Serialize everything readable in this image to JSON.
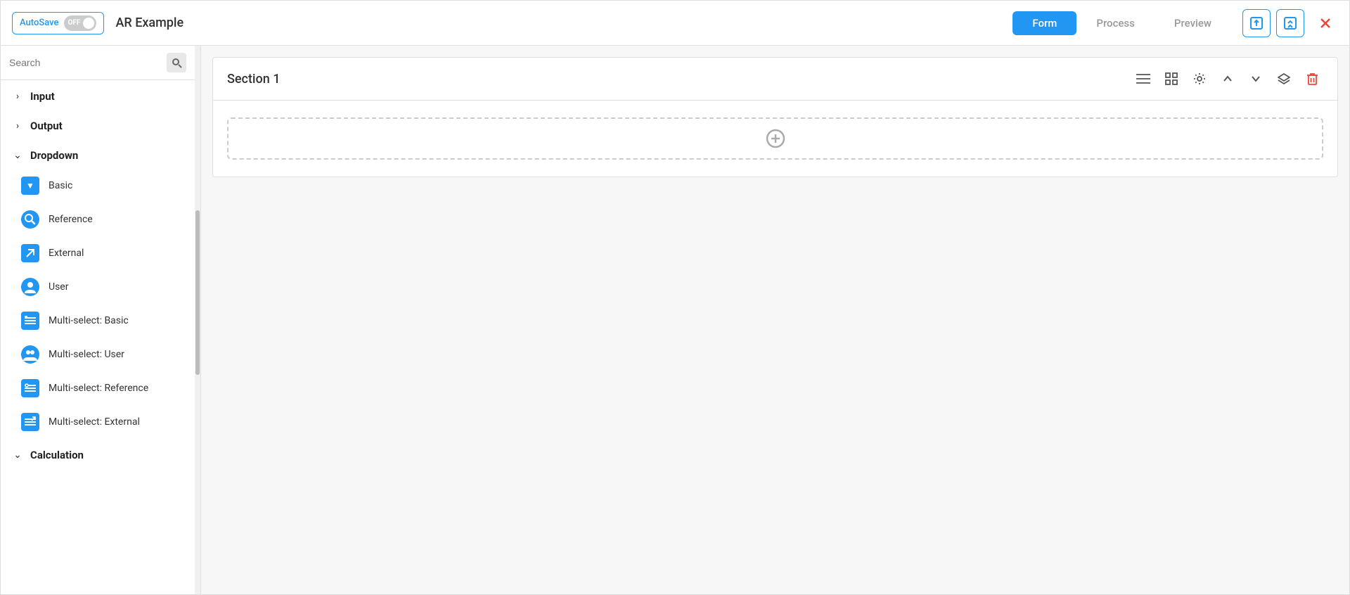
{
  "header": {
    "autosave_label": "AutoSave",
    "toggle_state": "OFF",
    "app_title": "AR Example",
    "tabs": [
      {
        "id": "form",
        "label": "Form",
        "active": true
      },
      {
        "id": "process",
        "label": "Process",
        "active": false
      },
      {
        "id": "preview",
        "label": "Preview",
        "active": false
      }
    ],
    "icon_export": "⬜",
    "icon_share": "⬛",
    "close_label": "✕"
  },
  "sidebar": {
    "search_placeholder": "Search",
    "groups": [
      {
        "id": "input",
        "label": "Input",
        "expanded": false,
        "chevron": "›"
      },
      {
        "id": "output",
        "label": "Output",
        "expanded": false,
        "chevron": "›"
      },
      {
        "id": "dropdown",
        "label": "Dropdown",
        "expanded": true,
        "chevron": "⌄",
        "items": [
          {
            "id": "basic",
            "label": "Basic",
            "icon": "dropdown-basic"
          },
          {
            "id": "reference",
            "label": "Reference",
            "icon": "reference"
          },
          {
            "id": "external",
            "label": "External",
            "icon": "external"
          },
          {
            "id": "user",
            "label": "User",
            "icon": "user"
          },
          {
            "id": "multi-basic",
            "label": "Multi-select: Basic",
            "icon": "multi-basic"
          },
          {
            "id": "multi-user",
            "label": "Multi-select: User",
            "icon": "multi-user"
          },
          {
            "id": "multi-reference",
            "label": "Multi-select: Reference",
            "icon": "multi-ref"
          },
          {
            "id": "multi-external",
            "label": "Multi-select: External",
            "icon": "multi-ext"
          }
        ]
      },
      {
        "id": "calculation",
        "label": "Calculation",
        "expanded": false,
        "chevron": "⌄"
      }
    ]
  },
  "content": {
    "section_title": "Section 1",
    "drop_zone_icon": "+",
    "section_actions": {
      "list_icon": "☰",
      "grid_icon": "⊞",
      "settings_icon": "⚙",
      "up_icon": "∧",
      "down_icon": "∨",
      "layer_icon": "▲",
      "delete_icon": "🗑"
    }
  }
}
